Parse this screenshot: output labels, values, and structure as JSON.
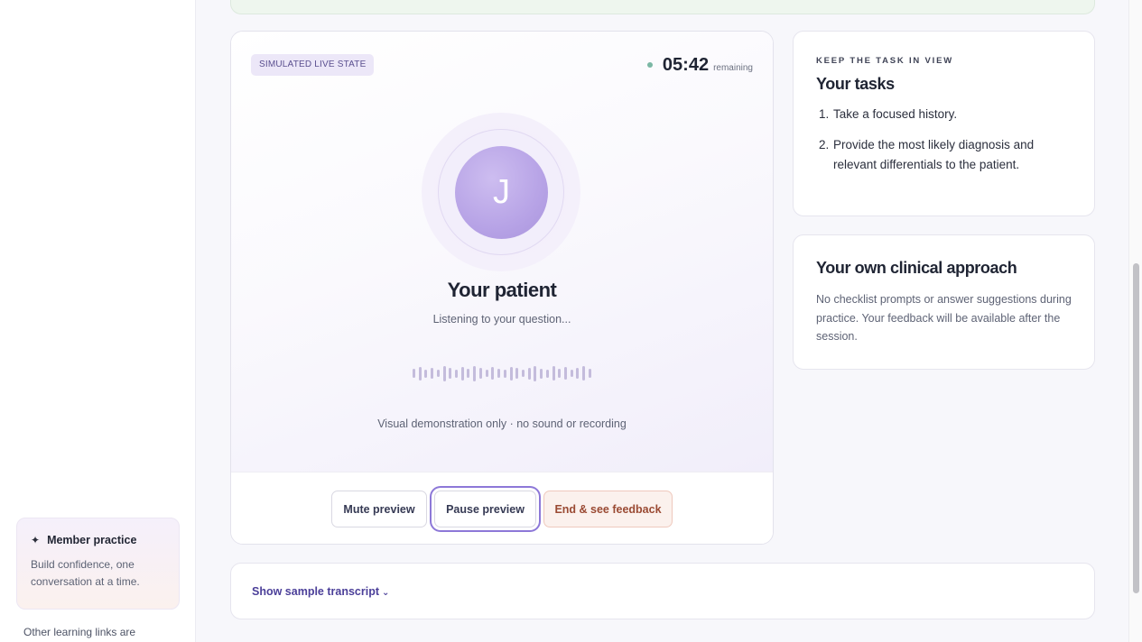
{
  "sidebar": {
    "member_card": {
      "icon": "sparkle-icon",
      "title": "Member practice",
      "description": "Build confidence, one conversation at a time."
    },
    "other_links_text": "Other learning links are"
  },
  "patient_panel": {
    "badge": "SIMULATED LIVE STATE",
    "timer": {
      "value": "05:42",
      "label": "remaining",
      "status_color": "#7bb7a4"
    },
    "avatar_initial": "J",
    "name": "Your patient",
    "status": "Listening to your question...",
    "waveform_levels": [
      0.45,
      0.8,
      0.35,
      0.6,
      0.3,
      0.9,
      0.55,
      0.35,
      0.75,
      0.4,
      0.95,
      0.6,
      0.3,
      0.7,
      0.45,
      0.35,
      0.8,
      0.55,
      0.3,
      0.65,
      0.9,
      0.5,
      0.35,
      0.85,
      0.4,
      0.7,
      0.3,
      0.6,
      0.85,
      0.45
    ],
    "demo_note": "Visual demonstration only · no sound or recording",
    "buttons": {
      "mute": "Mute preview",
      "pause": "Pause preview",
      "end": "End & see feedback"
    }
  },
  "tasks": {
    "eyebrow": "KEEP THE TASK IN VIEW",
    "title": "Your tasks",
    "items": [
      {
        "num": "1.",
        "text": "Take a focused history."
      },
      {
        "num": "2.",
        "text": "Provide the most likely diagnosis and relevant differentials to the patient."
      }
    ]
  },
  "approach": {
    "title": "Your own clinical approach",
    "text": "No checklist prompts or answer suggestions during practice. Your feedback will be available after the session."
  },
  "transcript": {
    "link_label": "Show sample transcript",
    "chevron": "⌄"
  },
  "colors": {
    "accent": "#8d78d8",
    "end_button_text": "#9a4a33",
    "link": "#4b3f99"
  }
}
